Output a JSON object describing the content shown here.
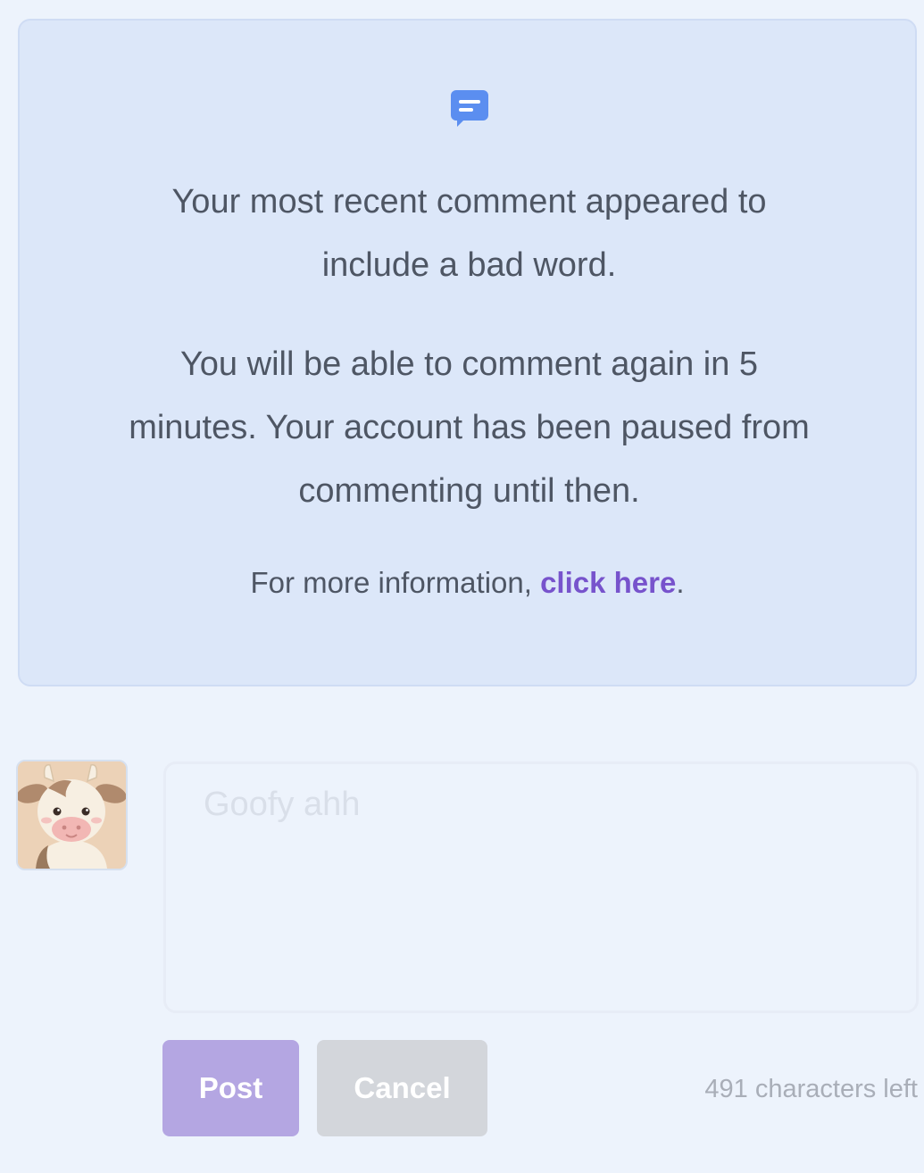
{
  "notice": {
    "icon": "message-icon",
    "line1": "Your most recent comment appeared to include a bad word.",
    "line2": "You will be able to comment again in 5 minutes. Your account has been paused from commenting until then.",
    "info_prefix": "For more information, ",
    "info_link": "click here",
    "info_suffix": "."
  },
  "comment_form": {
    "avatar_icon": "cow-avatar",
    "placeholder": "Goofy ahh",
    "post_label": "Post",
    "cancel_label": "Cancel",
    "chars_left": "491 characters left"
  },
  "colors": {
    "accent": "#7753cc",
    "info_blue": "#5b8ef0",
    "post_button": "#b4a6e2",
    "cancel_button": "#d3d6db"
  }
}
